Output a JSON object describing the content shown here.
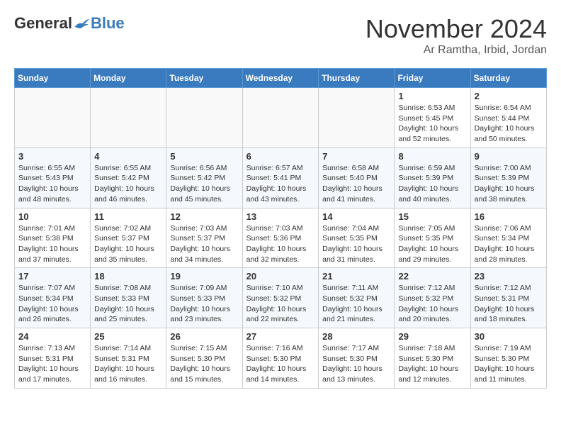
{
  "logo": {
    "general": "General",
    "blue": "Blue"
  },
  "title": "November 2024",
  "location": "Ar Ramtha, Irbid, Jordan",
  "days_of_week": [
    "Sunday",
    "Monday",
    "Tuesday",
    "Wednesday",
    "Thursday",
    "Friday",
    "Saturday"
  ],
  "weeks": [
    [
      {
        "day": "",
        "empty": true
      },
      {
        "day": "",
        "empty": true
      },
      {
        "day": "",
        "empty": true
      },
      {
        "day": "",
        "empty": true
      },
      {
        "day": "",
        "empty": true
      },
      {
        "day": "1",
        "sunrise": "6:53 AM",
        "sunset": "5:45 PM",
        "daylight": "10 hours and 52 minutes."
      },
      {
        "day": "2",
        "sunrise": "6:54 AM",
        "sunset": "5:44 PM",
        "daylight": "10 hours and 50 minutes."
      }
    ],
    [
      {
        "day": "3",
        "sunrise": "6:55 AM",
        "sunset": "5:43 PM",
        "daylight": "10 hours and 48 minutes."
      },
      {
        "day": "4",
        "sunrise": "6:55 AM",
        "sunset": "5:42 PM",
        "daylight": "10 hours and 46 minutes."
      },
      {
        "day": "5",
        "sunrise": "6:56 AM",
        "sunset": "5:42 PM",
        "daylight": "10 hours and 45 minutes."
      },
      {
        "day": "6",
        "sunrise": "6:57 AM",
        "sunset": "5:41 PM",
        "daylight": "10 hours and 43 minutes."
      },
      {
        "day": "7",
        "sunrise": "6:58 AM",
        "sunset": "5:40 PM",
        "daylight": "10 hours and 41 minutes."
      },
      {
        "day": "8",
        "sunrise": "6:59 AM",
        "sunset": "5:39 PM",
        "daylight": "10 hours and 40 minutes."
      },
      {
        "day": "9",
        "sunrise": "7:00 AM",
        "sunset": "5:39 PM",
        "daylight": "10 hours and 38 minutes."
      }
    ],
    [
      {
        "day": "10",
        "sunrise": "7:01 AM",
        "sunset": "5:38 PM",
        "daylight": "10 hours and 37 minutes."
      },
      {
        "day": "11",
        "sunrise": "7:02 AM",
        "sunset": "5:37 PM",
        "daylight": "10 hours and 35 minutes."
      },
      {
        "day": "12",
        "sunrise": "7:03 AM",
        "sunset": "5:37 PM",
        "daylight": "10 hours and 34 minutes."
      },
      {
        "day": "13",
        "sunrise": "7:03 AM",
        "sunset": "5:36 PM",
        "daylight": "10 hours and 32 minutes."
      },
      {
        "day": "14",
        "sunrise": "7:04 AM",
        "sunset": "5:35 PM",
        "daylight": "10 hours and 31 minutes."
      },
      {
        "day": "15",
        "sunrise": "7:05 AM",
        "sunset": "5:35 PM",
        "daylight": "10 hours and 29 minutes."
      },
      {
        "day": "16",
        "sunrise": "7:06 AM",
        "sunset": "5:34 PM",
        "daylight": "10 hours and 28 minutes."
      }
    ],
    [
      {
        "day": "17",
        "sunrise": "7:07 AM",
        "sunset": "5:34 PM",
        "daylight": "10 hours and 26 minutes."
      },
      {
        "day": "18",
        "sunrise": "7:08 AM",
        "sunset": "5:33 PM",
        "daylight": "10 hours and 25 minutes."
      },
      {
        "day": "19",
        "sunrise": "7:09 AM",
        "sunset": "5:33 PM",
        "daylight": "10 hours and 23 minutes."
      },
      {
        "day": "20",
        "sunrise": "7:10 AM",
        "sunset": "5:32 PM",
        "daylight": "10 hours and 22 minutes."
      },
      {
        "day": "21",
        "sunrise": "7:11 AM",
        "sunset": "5:32 PM",
        "daylight": "10 hours and 21 minutes."
      },
      {
        "day": "22",
        "sunrise": "7:12 AM",
        "sunset": "5:32 PM",
        "daylight": "10 hours and 20 minutes."
      },
      {
        "day": "23",
        "sunrise": "7:12 AM",
        "sunset": "5:31 PM",
        "daylight": "10 hours and 18 minutes."
      }
    ],
    [
      {
        "day": "24",
        "sunrise": "7:13 AM",
        "sunset": "5:31 PM",
        "daylight": "10 hours and 17 minutes."
      },
      {
        "day": "25",
        "sunrise": "7:14 AM",
        "sunset": "5:31 PM",
        "daylight": "10 hours and 16 minutes."
      },
      {
        "day": "26",
        "sunrise": "7:15 AM",
        "sunset": "5:30 PM",
        "daylight": "10 hours and 15 minutes."
      },
      {
        "day": "27",
        "sunrise": "7:16 AM",
        "sunset": "5:30 PM",
        "daylight": "10 hours and 14 minutes."
      },
      {
        "day": "28",
        "sunrise": "7:17 AM",
        "sunset": "5:30 PM",
        "daylight": "10 hours and 13 minutes."
      },
      {
        "day": "29",
        "sunrise": "7:18 AM",
        "sunset": "5:30 PM",
        "daylight": "10 hours and 12 minutes."
      },
      {
        "day": "30",
        "sunrise": "7:19 AM",
        "sunset": "5:30 PM",
        "daylight": "10 hours and 11 minutes."
      }
    ]
  ]
}
